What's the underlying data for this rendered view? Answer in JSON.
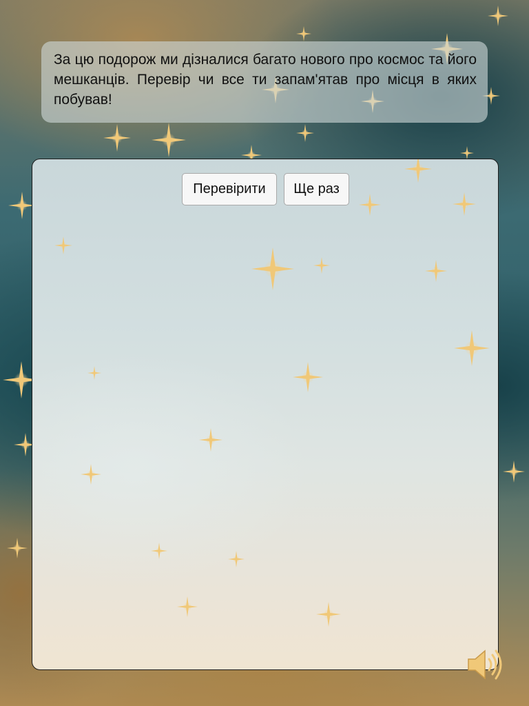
{
  "intro": {
    "text": "За цю подорож ми дізналися багато нового про космос та його мешканців. Перевір чи все ти запам'ятав про місця в яких побував!"
  },
  "controls": {
    "check_label": "Перевірити",
    "retry_label": "Ще раз"
  },
  "sound": {
    "icon": "speaker-icon"
  },
  "colors": {
    "star": "#e8c27a",
    "button_bg": "#f7f7f7",
    "panel_border": "#1b1b1b"
  }
}
